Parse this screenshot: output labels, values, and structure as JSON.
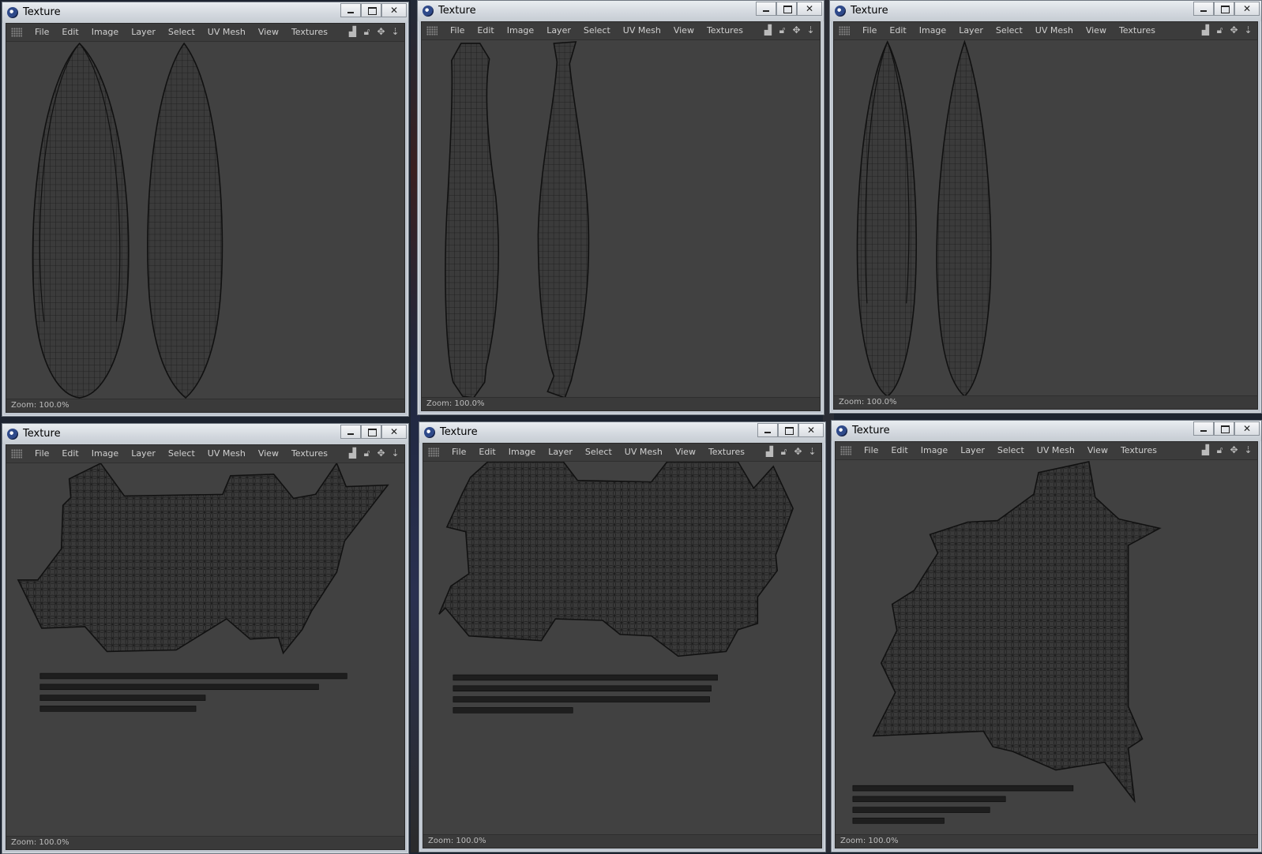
{
  "windows": [
    {
      "title": "Texture",
      "status": "Zoom: 100.0%"
    },
    {
      "title": "Texture",
      "status": "Zoom: 100.0%"
    },
    {
      "title": "Texture",
      "status": "Zoom: 100.0%"
    },
    {
      "title": "Texture",
      "status": "Zoom: 100.0%"
    },
    {
      "title": "Texture",
      "status": "Zoom: 100.0%"
    },
    {
      "title": "Texture",
      "status": "Zoom: 100.0%"
    }
  ],
  "menu": [
    "File",
    "Edit",
    "Image",
    "Layer",
    "Select",
    "UV Mesh",
    "View",
    "Textures"
  ],
  "window_buttons": {
    "minimize": "–",
    "maximize": "□",
    "close": "✕"
  },
  "tool_icons": [
    "histogram-icon",
    "lock-icon",
    "move-icon",
    "scroll-down-icon"
  ],
  "colors": {
    "viewport": "#414141",
    "menubar": "#3c3c3c",
    "mesh_line": "#111111",
    "titlebar": "#d4d9df"
  }
}
